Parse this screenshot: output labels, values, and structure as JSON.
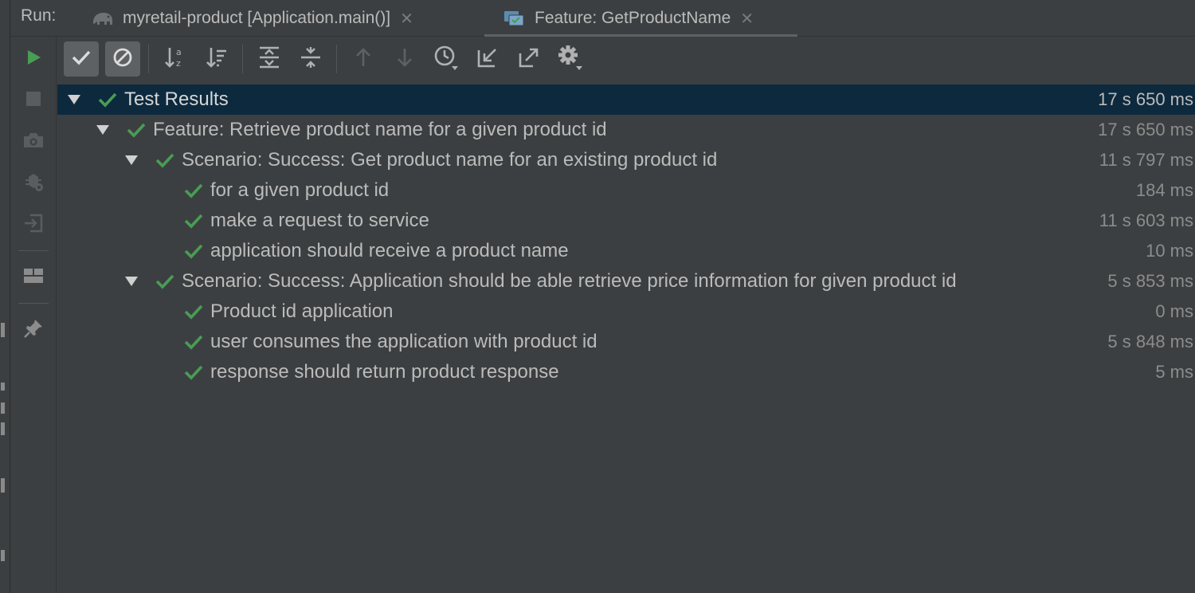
{
  "tabs": {
    "run_label": "Run:",
    "items": [
      {
        "label": "myretail-product [Application.main()]",
        "icon": "gradle-elephant-icon",
        "active": false
      },
      {
        "label": "Feature: GetProductName",
        "icon": "test-run-icon",
        "active": true
      }
    ]
  },
  "vertical_toolbar": [
    {
      "icon": "run-icon",
      "color": "#499c54"
    },
    {
      "icon": "stop-icon"
    },
    {
      "icon": "camera-icon"
    },
    {
      "icon": "debug-settings-icon"
    },
    {
      "icon": "exit-icon"
    },
    {
      "icon": "layout-icon"
    },
    {
      "icon": "pin-icon"
    }
  ],
  "toolbar": [
    {
      "icon": "show-passed-icon",
      "toggled": true
    },
    {
      "icon": "show-ignored-icon",
      "toggled": true
    },
    {
      "icon": "sort-alphabetically-icon"
    },
    {
      "icon": "sort-by-duration-icon"
    },
    {
      "icon": "expand-all-icon"
    },
    {
      "icon": "collapse-all-icon"
    },
    {
      "icon": "previous-failed-icon"
    },
    {
      "icon": "next-failed-icon"
    },
    {
      "icon": "test-history-icon"
    },
    {
      "icon": "import-tests-icon"
    },
    {
      "icon": "export-results-icon"
    },
    {
      "icon": "settings-gear-icon"
    }
  ],
  "tree": [
    {
      "label": "Test Results",
      "time": "17 s 650 ms",
      "level": 0,
      "expandable": true,
      "selected": true
    },
    {
      "label": "Feature: Retrieve product name for a given product id",
      "time": "17 s 650 ms",
      "level": 1,
      "expandable": true
    },
    {
      "label": "Scenario: Success: Get product name for an existing product id",
      "time": "11 s 797 ms",
      "level": 2,
      "expandable": true
    },
    {
      "label": "for a given product id",
      "time": "184 ms",
      "level": 3,
      "expandable": false
    },
    {
      "label": "make a request to service",
      "time": "11 s 603 ms",
      "level": 3,
      "expandable": false
    },
    {
      "label": "application should receive a product name",
      "time": "10 ms",
      "level": 3,
      "expandable": false
    },
    {
      "label": "Scenario: Success: Application should be able retrieve price information for given product id",
      "time": "5 s 853 ms",
      "level": 2,
      "expandable": true
    },
    {
      "label": "Product id application",
      "time": "0 ms",
      "level": 3,
      "expandable": false
    },
    {
      "label": "user consumes the application with product id",
      "time": "5 s 848 ms",
      "level": 3,
      "expandable": false
    },
    {
      "label": "response should return product response",
      "time": "5 ms",
      "level": 3,
      "expandable": false
    }
  ],
  "colors": {
    "pass": "#499c54",
    "selection": "#0d293e",
    "background": "#3c3f41"
  }
}
